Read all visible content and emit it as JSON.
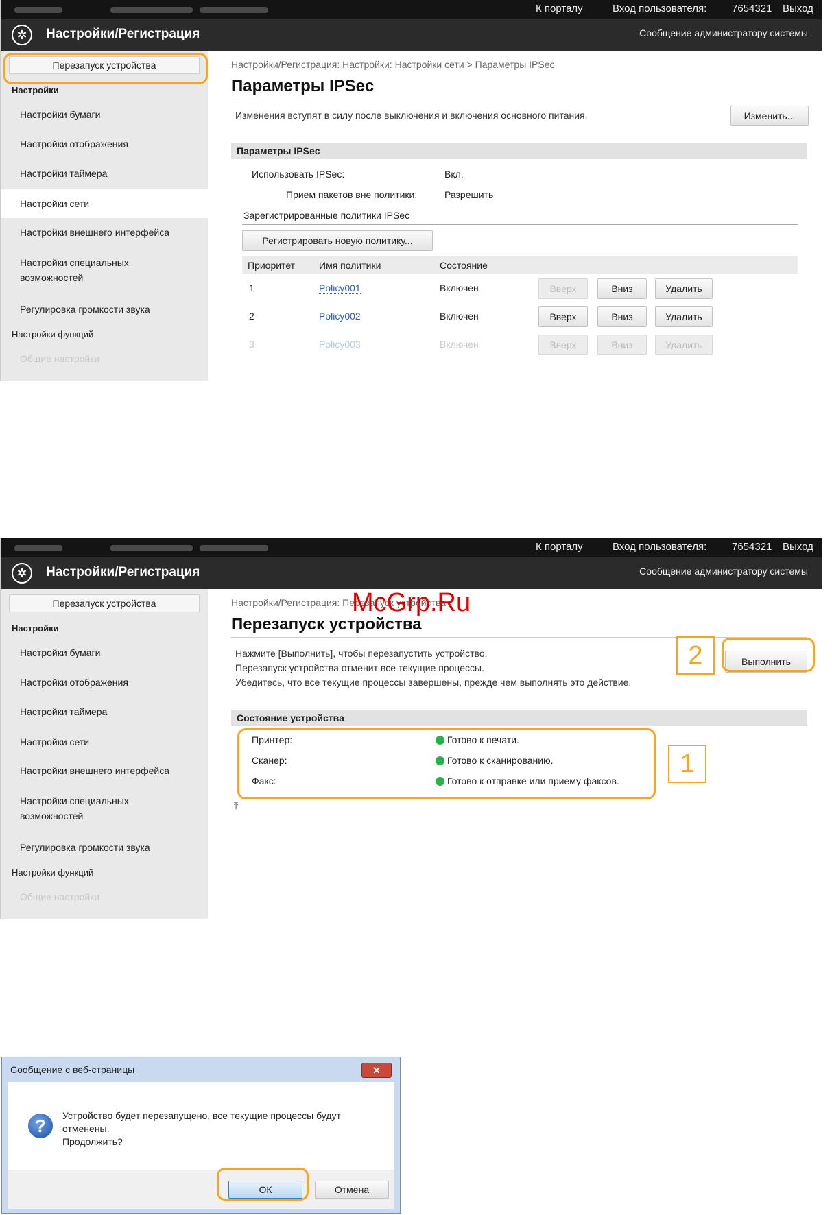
{
  "header": {
    "portal": "К порталу",
    "login_label": "Вход пользователя:",
    "login_user": "7654321",
    "logout": "Выход",
    "app_title": "Настройки/Регистрация",
    "admin_message": "Сообщение администратору системы",
    "logo_icon": "canon-logo-icon"
  },
  "sidebar": {
    "restart": "Перезапуск устройства",
    "settings_header": "Настройки",
    "items": [
      "Настройки бумаги",
      "Настройки отображения",
      "Настройки таймера",
      "Настройки сети",
      "Настройки внешнего интерфейса",
      "Настройки специальных возможностей",
      "Регулировка громкости звука"
    ],
    "functions_header": "Настройки функций",
    "general": "Общие настройки"
  },
  "screen1": {
    "breadcrumb": "Настройки/Регистрация: Настройки: Настройки сети > Параметры IPSec",
    "title": "Параметры IPSec",
    "note": "Изменения вступят в силу после выключения и включения основного питания.",
    "edit_button": "Изменить...",
    "section": "Параметры IPSec",
    "use_ipsec_label": "Использовать IPSec:",
    "use_ipsec_value": "Вкл.",
    "receive_label": "Прием пакетов вне политики:",
    "receive_value": "Разрешить",
    "policies_header": "Зарегистрированные политики IPSec",
    "register_button": "Регистрировать новую политику...",
    "columns": [
      "Приоритет",
      "Имя политики",
      "Состояние"
    ],
    "rows": [
      {
        "priority": "1",
        "name": "Policy001",
        "state": "Включен"
      },
      {
        "priority": "2",
        "name": "Policy002",
        "state": "Включен"
      },
      {
        "priority": "3",
        "name": "Policy003",
        "state": "Включен"
      }
    ],
    "up": "Вверх",
    "down": "Вниз",
    "delete": "Удалить"
  },
  "screen2": {
    "breadcrumb": "Настройки/Регистрация: Перезапуск устройства",
    "title": "Перезапуск устройства",
    "instructions": [
      "Нажмите [Выполнить], чтобы перезапустить устройство.",
      "Перезапуск устройства отменит все текущие процессы.",
      "Убедитесь, что все текущие процессы завершены, прежде чем выполнять это действие."
    ],
    "execute_button": "Выполнить",
    "status_section": "Состояние устройства",
    "status": [
      {
        "label": "Принтер:",
        "value": "Готово к печати."
      },
      {
        "label": "Сканер:",
        "value": "Готово к сканированию."
      },
      {
        "label": "Факс:",
        "value": "Готово к отправке или приему факсов."
      }
    ],
    "callout_1": "1",
    "callout_2": "2",
    "status_color": "#28b24b"
  },
  "watermark": "McGrp.Ru",
  "dialog": {
    "title": "Сообщение с веб-страницы",
    "close": "✕",
    "message_lines": [
      "Устройство будет перезапущено, все текущие процессы будут",
      "отменены.",
      "Продолжить?"
    ],
    "ok": "ОК",
    "cancel": "Отмена"
  },
  "accent_color": "#f5a623"
}
